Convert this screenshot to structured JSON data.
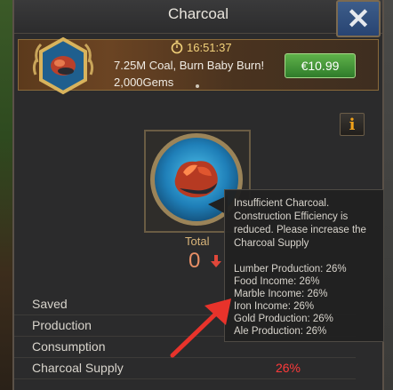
{
  "window": {
    "title": "Charcoal"
  },
  "offer": {
    "timer": "16:51:37",
    "title": "7.25M Coal, Burn Baby Burn!",
    "gems": "2,000Gems",
    "price": "€10.99"
  },
  "resource": {
    "total_label": "Total",
    "total_value": "0"
  },
  "stats": [
    {
      "label": "Saved",
      "value": ""
    },
    {
      "label": "Production",
      "value": ""
    },
    {
      "label": "Consumption",
      "value": ""
    },
    {
      "label": "Charcoal Supply",
      "value": "26%"
    }
  ],
  "tooltip": {
    "warning": "Insufficient Charcoal. Construction Efficiency is reduced. Please increase the Charcoal Supply",
    "items": [
      "Lumber Production: 26%",
      "Food Income: 26%",
      "Marble Income: 26%",
      "Iron Income: 26%",
      "Gold Production: 26%",
      "Ale Production: 26%"
    ]
  },
  "colors": {
    "accent_gold": "#d9b57a",
    "price_green": "#3d8f35",
    "negative_red": "#ff3a3a",
    "total_orange": "#e88f66"
  },
  "icons": [
    "close-icon",
    "coal-offer-icon",
    "stopwatch-icon",
    "info-icon",
    "coal-resource-icon",
    "down-arrow-icon",
    "pointer-arrow-icon"
  ]
}
